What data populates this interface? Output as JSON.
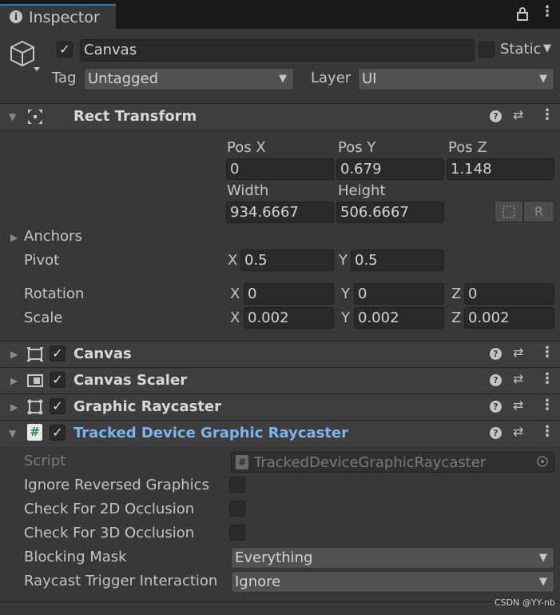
{
  "tab": {
    "title": "Inspector"
  },
  "header": {
    "active": true,
    "name": "Canvas",
    "static_label": "Static",
    "tag_label": "Tag",
    "tag_value": "Untagged",
    "layer_label": "Layer",
    "layer_value": "UI"
  },
  "rect_transform": {
    "title": "Rect Transform",
    "posx_label": "Pos X",
    "posy_label": "Pos Y",
    "posz_label": "Pos Z",
    "posx": "0",
    "posy": "0.679",
    "posz": "1.148",
    "width_label": "Width",
    "height_label": "Height",
    "width": "934.6667",
    "height": "506.6667",
    "anchors_label": "Anchors",
    "pivot_label": "Pivot",
    "pivot_x": "0.5",
    "pivot_y": "0.5",
    "rotation_label": "Rotation",
    "rot_x": "0",
    "rot_y": "0",
    "rot_z": "0",
    "scale_label": "Scale",
    "scale_x": "0.002",
    "scale_y": "0.002",
    "scale_z": "0.002",
    "axis_x": "X",
    "axis_y": "Y",
    "axis_z": "Z",
    "raw_button": "R"
  },
  "components": [
    {
      "title": "Canvas"
    },
    {
      "title": "Canvas Scaler"
    },
    {
      "title": "Graphic Raycaster"
    }
  ],
  "tracked": {
    "title": "Tracked Device Graphic Raycaster",
    "title_color": "#7cb4f0",
    "script_label": "Script",
    "script_value": "TrackedDeviceGraphicRaycaster",
    "ignore_reversed_label": "Ignore Reversed Graphics",
    "check2d_label": "Check For 2D Occlusion",
    "check3d_label": "Check For 3D Occlusion",
    "blocking_mask_label": "Blocking Mask",
    "blocking_mask_value": "Everything",
    "raycast_trigger_label": "Raycast Trigger Interaction",
    "raycast_trigger_value": "Ignore"
  },
  "watermark": "CSDN @YY-nb",
  "icons": [
    "info-icon",
    "lock-icon",
    "menu-icon",
    "gameobject-cube-icon",
    "move-tool-icon",
    "help-icon",
    "preset-icon",
    "kebab-icon",
    "canvas-icon",
    "canvas-scaler-icon",
    "graphic-raycaster-icon",
    "script-icon",
    "object-picker-icon",
    "blueprint-icon"
  ]
}
